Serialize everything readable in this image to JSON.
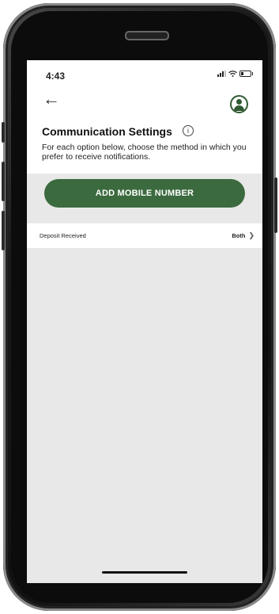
{
  "status": {
    "time": "4:43"
  },
  "header": {
    "back_icon": "arrow-left-icon",
    "profile_icon": "user-circle-icon"
  },
  "page": {
    "title": "Communication Settings",
    "info_symbol": "i",
    "description": "For each option below, choose the method in which you prefer to receive notifications."
  },
  "actions": {
    "add_mobile_label": "ADD MOBILE NUMBER"
  },
  "settings": [
    {
      "label": "Deposit Received",
      "value": "Both"
    }
  ],
  "colors": {
    "accent": "#3b6a3e",
    "screen_bg": "#e8e8e8"
  }
}
